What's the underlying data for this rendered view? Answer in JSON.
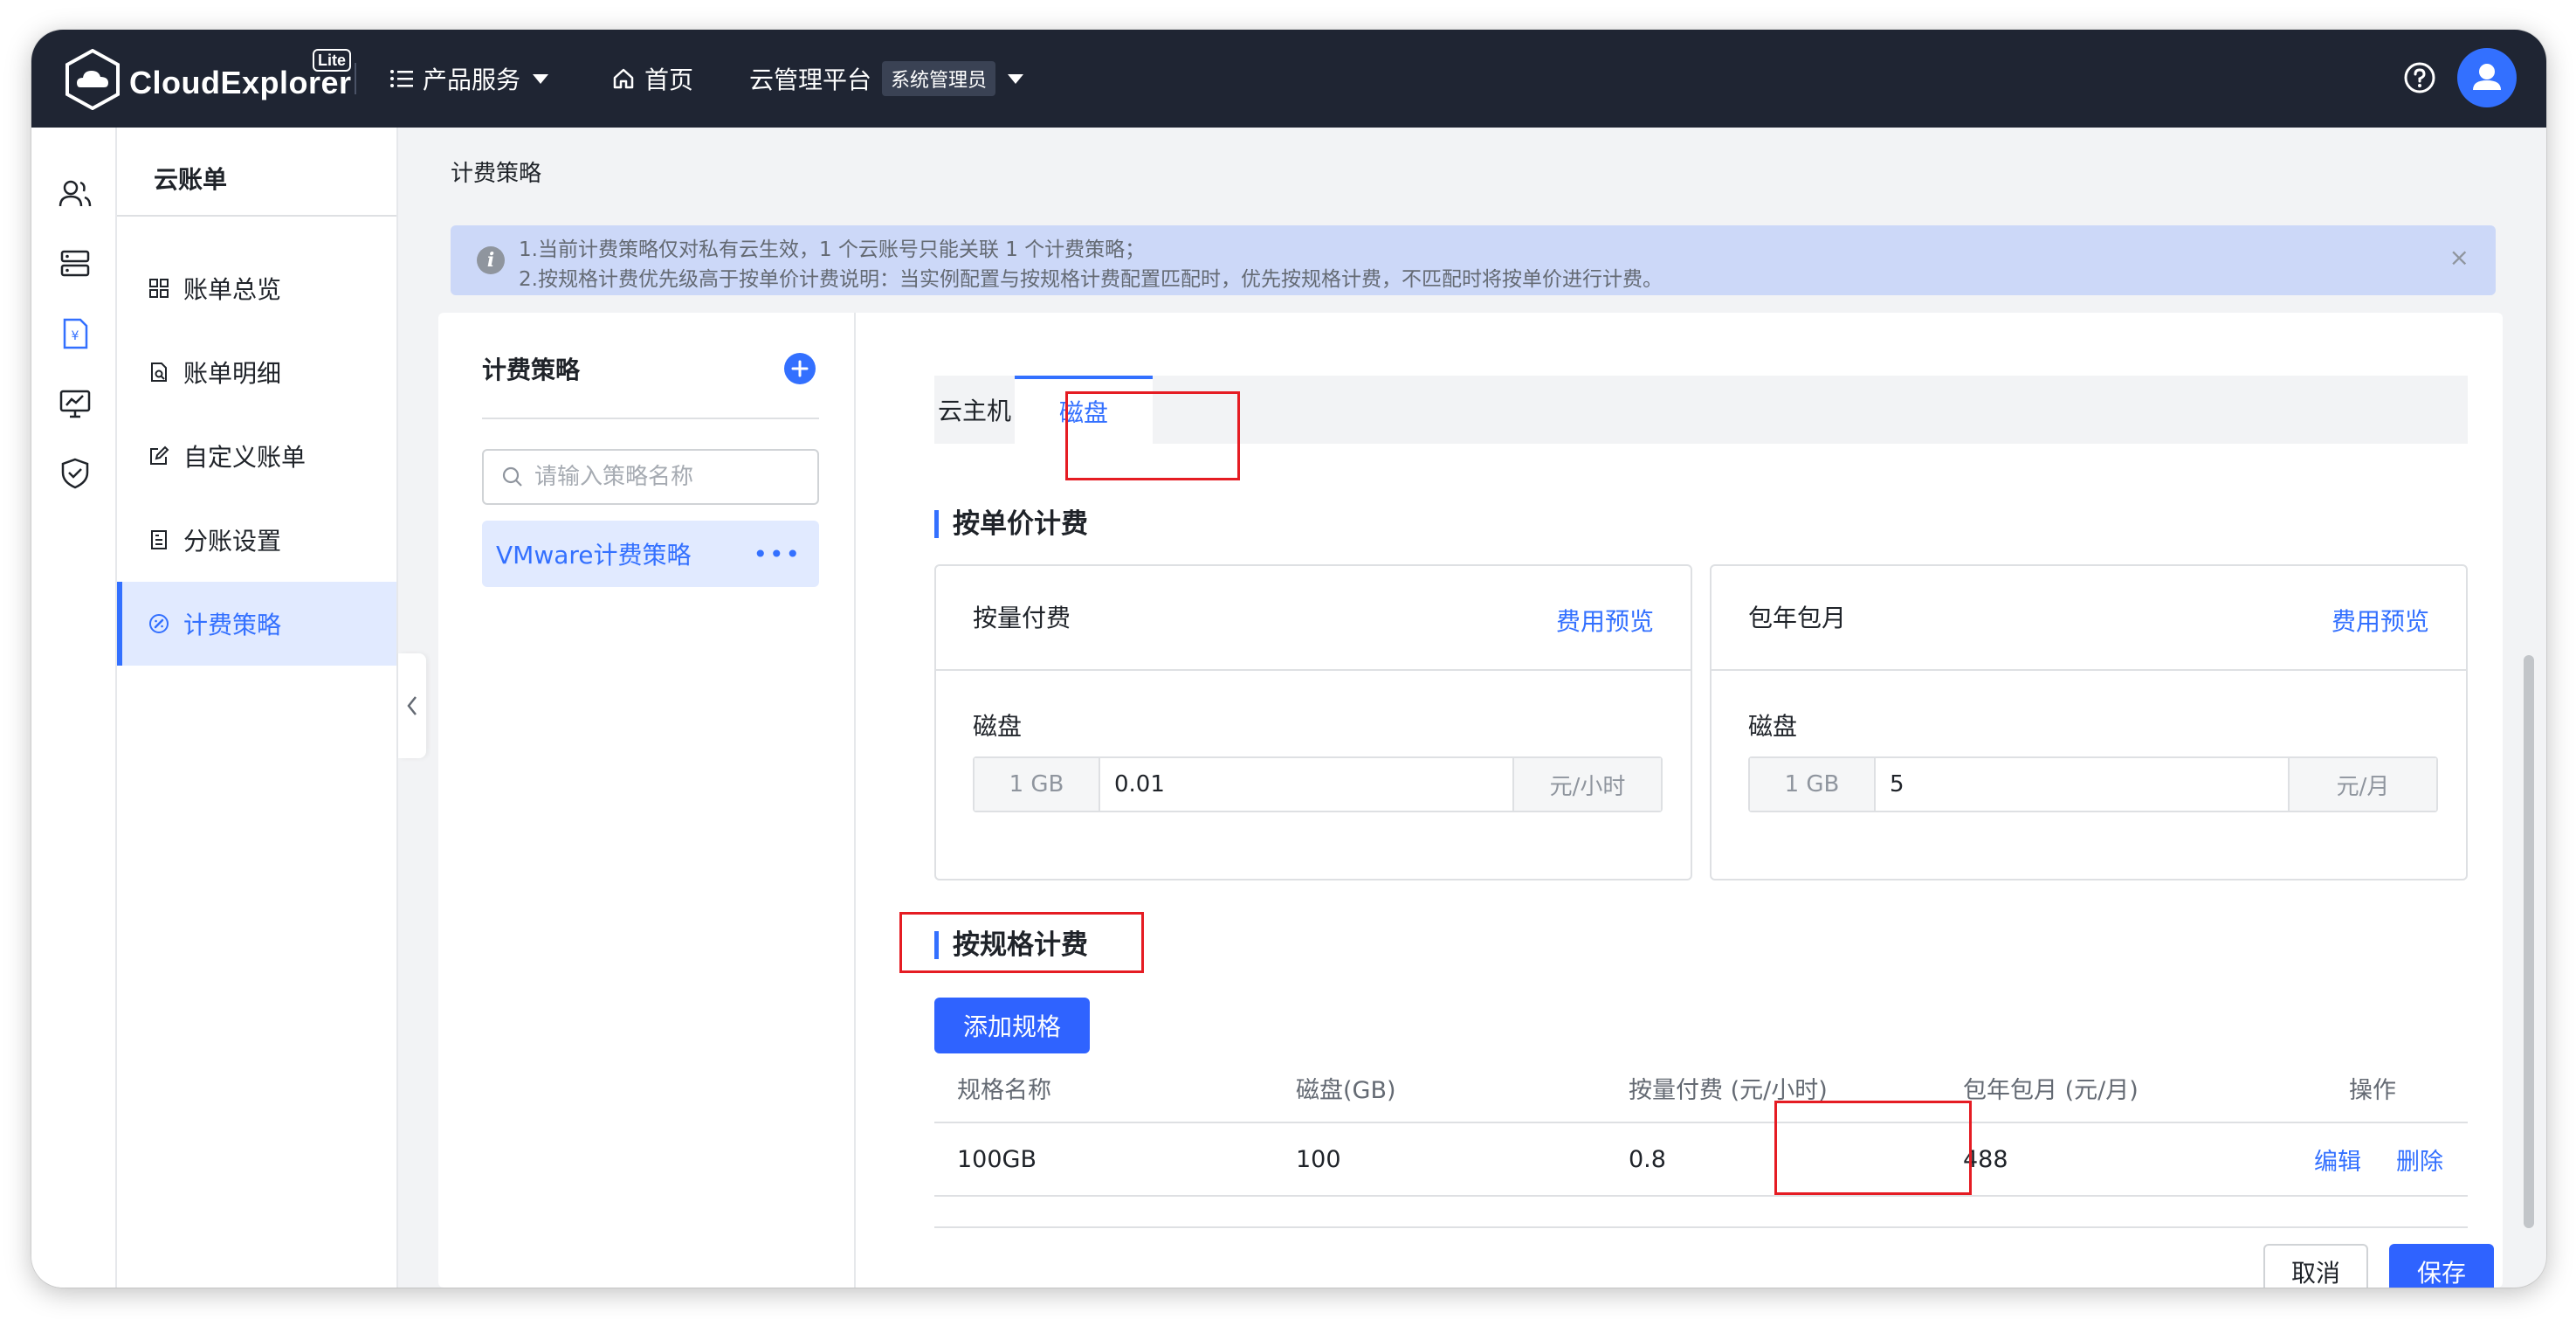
{
  "topbar": {
    "logo_text": "CloudExplorer",
    "logo_badge": "Lite",
    "products_label": "产品服务",
    "home_label": "首页",
    "platform_label": "云管理平台",
    "role_badge": "系统管理员"
  },
  "rail": {
    "icons": [
      "users-icon",
      "server-icon",
      "bill-icon",
      "monitor-icon",
      "shield-icon"
    ]
  },
  "subnav": {
    "title": "云账单",
    "items": [
      {
        "label": "账单总览",
        "icon": "grid-icon"
      },
      {
        "label": "账单明细",
        "icon": "file-search-icon"
      },
      {
        "label": "自定义账单",
        "icon": "edit-icon"
      },
      {
        "label": "分账设置",
        "icon": "split-icon"
      },
      {
        "label": "计费策略",
        "icon": "pricing-icon",
        "active": true
      }
    ]
  },
  "page": {
    "title": "计费策略"
  },
  "alert": {
    "line1": "1.当前计费策略仅对私有云生效，1 个云账号只能关联 1 个计费策略；",
    "line2": "2.按规格计费优先级高于按单价计费说明：当实例配置与按规格计费配置匹配时，优先按规格计费，不匹配时将按单价进行计费。",
    "close": "×"
  },
  "policy": {
    "heading": "计费策略",
    "search_placeholder": "请输入策略名称",
    "items": [
      {
        "name": "VMware计费策略",
        "more": "•••"
      }
    ]
  },
  "tabs": [
    {
      "label": "云主机",
      "active": false
    },
    {
      "label": "磁盘",
      "active": true
    }
  ],
  "unit_price": {
    "title": "按单价计费",
    "pay_as_you_go": {
      "title": "按量付费",
      "link": "费用预览",
      "field_label": "磁盘",
      "prefix": "1 GB",
      "value": "0.01",
      "suffix": "元/小时"
    },
    "subscription": {
      "title": "包年包月",
      "link": "费用预览",
      "field_label": "磁盘",
      "prefix": "1 GB",
      "value": "5",
      "suffix": "元/月"
    }
  },
  "spec_price": {
    "title": "按规格计费",
    "add_button": "添加规格",
    "columns": [
      "规格名称",
      "磁盘(GB)",
      "按量付费 (元/小时)",
      "包年包月 (元/月)",
      "操作"
    ],
    "rows": [
      {
        "name": "100GB",
        "disk": "100",
        "hourly": "0.8",
        "monthly": "488",
        "edit": "编辑",
        "delete": "删除"
      }
    ]
  },
  "footer": {
    "cancel": "取消",
    "save": "保存"
  },
  "colors": {
    "accent": "#3370ff",
    "topbar": "#1f2533",
    "highlight": "#e51c23"
  }
}
